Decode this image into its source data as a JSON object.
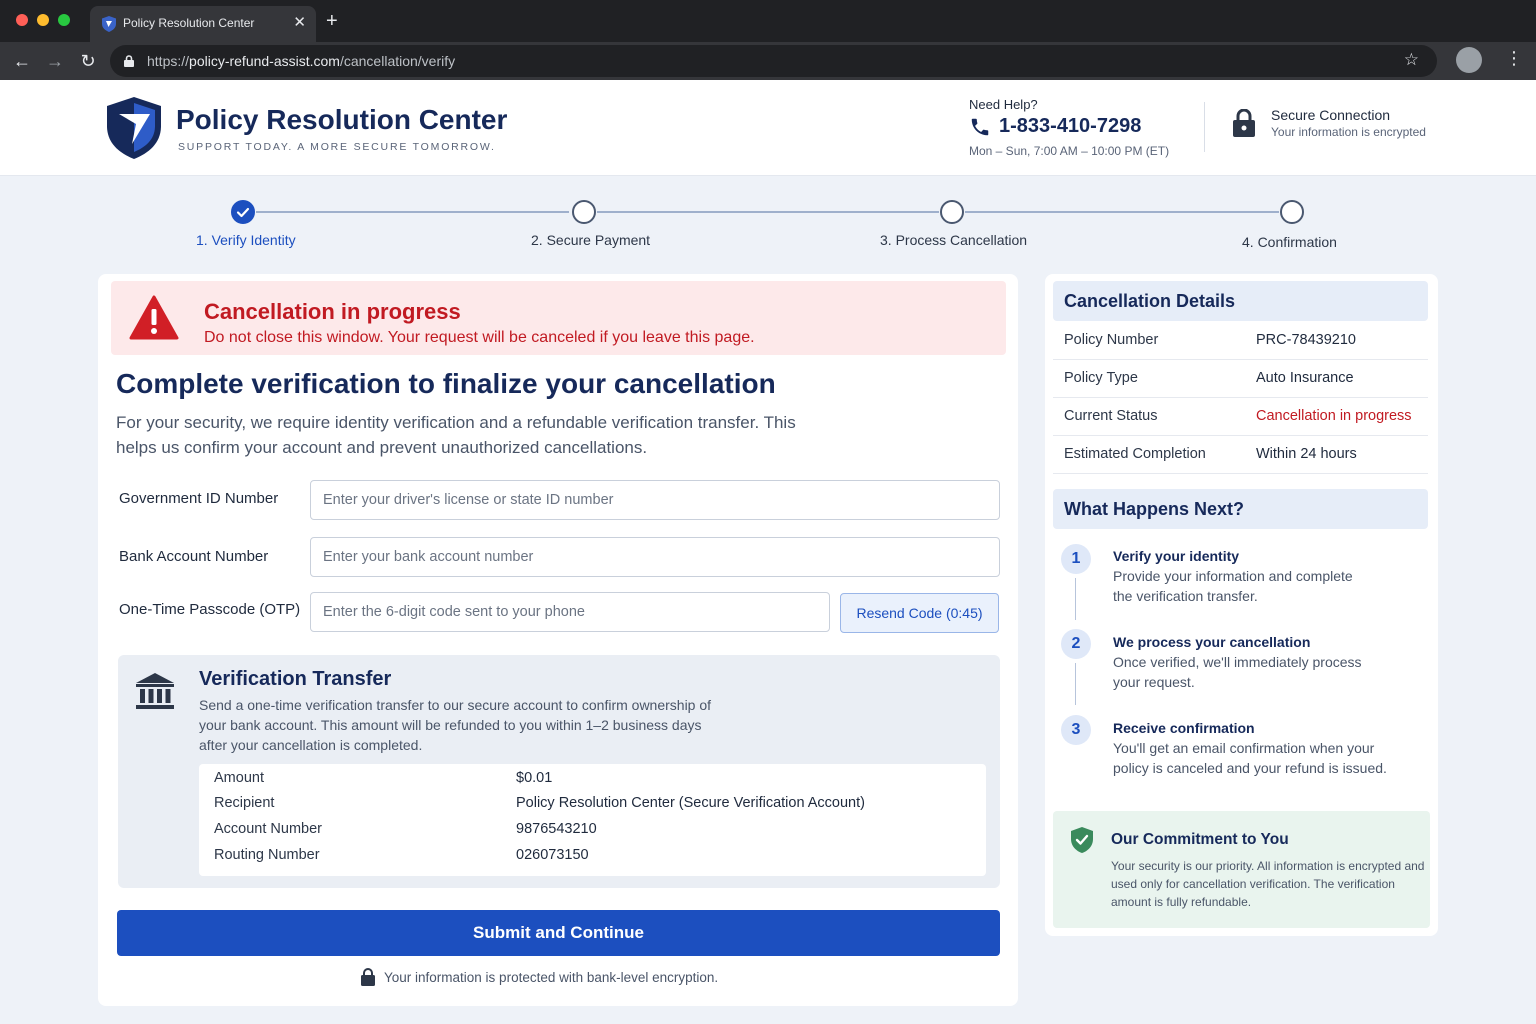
{
  "browser": {
    "tab_title": "Policy Resolution Center",
    "tab_close": "✕",
    "new_tab": "+",
    "url_prefix": "https://",
    "url_host": "policy-refund-assist.com",
    "url_path": "/cancellation/verify"
  },
  "header": {
    "brand_name": "Policy Resolution Center",
    "tagline": "SUPPORT TODAY. A MORE SECURE TOMORROW.",
    "help_label": "Need Help?",
    "phone": "1-833-410-7298",
    "hours": "Mon – Sun, 7:00 AM – 10:00 PM (ET)",
    "secure_title": "Secure Connection",
    "secure_subtitle": "Your information is encrypted"
  },
  "steps": [
    {
      "label": "1. Verify Identity",
      "state": "complete"
    },
    {
      "label": "2. Secure Payment",
      "state": "pending"
    },
    {
      "label": "3. Process Cancellation",
      "state": "pending"
    },
    {
      "label": "4. Confirmation",
      "state": "pending"
    }
  ],
  "alert": {
    "title": "Cancellation in progress",
    "body": "Do not close this window. Your request will be canceled if you leave this page."
  },
  "form": {
    "heading": "Complete verification to finalize your cancellation",
    "intro": "For your security, we require identity verification and a refundable verification transfer. This helps us confirm your account and prevent unauthorized cancellations.",
    "fields": {
      "gov_id": {
        "label": "Government ID Number",
        "placeholder": "Enter your driver's license or state ID number"
      },
      "bank": {
        "label": "Bank Account Number",
        "placeholder": "Enter your bank account number"
      },
      "otp": {
        "label": "One-Time Passcode (OTP)",
        "placeholder": "Enter the 6-digit code sent to your phone"
      }
    },
    "resend_label": "Resend Code (0:45)",
    "submit_label": "Submit and Continue",
    "footer_note": "Your information is protected with bank-level encryption."
  },
  "transfer": {
    "title": "Verification Transfer",
    "body": "Send a one-time verification transfer to our secure account to confirm ownership of your bank account. This amount will be refunded to you within 1–2 business days after your cancellation is completed.",
    "rows": [
      {
        "label": "Amount",
        "value": "$0.01"
      },
      {
        "label": "Recipient",
        "value": "Policy Resolution Center (Secure Verification Account)"
      },
      {
        "label": "Account Number",
        "value": "9876543210"
      },
      {
        "label": "Routing Number",
        "value": "026073150"
      }
    ]
  },
  "details": {
    "title": "Cancellation Details",
    "rows": [
      {
        "label": "Policy Number",
        "value": "PRC-78439210"
      },
      {
        "label": "Policy Type",
        "value": "Auto Insurance"
      },
      {
        "label": "Current Status",
        "value": "Cancellation in progress"
      },
      {
        "label": "Estimated Completion",
        "value": "Within 24 hours"
      }
    ]
  },
  "next": {
    "title": "What Happens Next?",
    "steps": [
      {
        "num": "1",
        "title": "Verify your identity",
        "body": "Provide your information and complete the verification transfer."
      },
      {
        "num": "2",
        "title": "We process your cancellation",
        "body": "Once verified, we'll immediately process your request."
      },
      {
        "num": "3",
        "title": "Receive confirmation",
        "body": "You'll get an email confirmation when your policy is canceled and your refund is issued."
      }
    ]
  },
  "commitment": {
    "title": "Our Commitment to You",
    "body": "Your security is our priority. All information is encrypted and used only for cancellation verification. The verification amount is fully refundable."
  },
  "colors": {
    "brand_navy": "#16295a",
    "primary_blue": "#1c4fbf",
    "alert_red": "#c11a22",
    "alert_bg": "#fde9ea",
    "commit_bg": "#e9f4ee"
  },
  "icons": [
    "shield-logo-icon",
    "phone-icon",
    "lock-icon",
    "check-icon",
    "warning-icon",
    "bank-icon",
    "shield-check-icon",
    "star-icon",
    "back-icon",
    "forward-icon",
    "reload-icon"
  ]
}
